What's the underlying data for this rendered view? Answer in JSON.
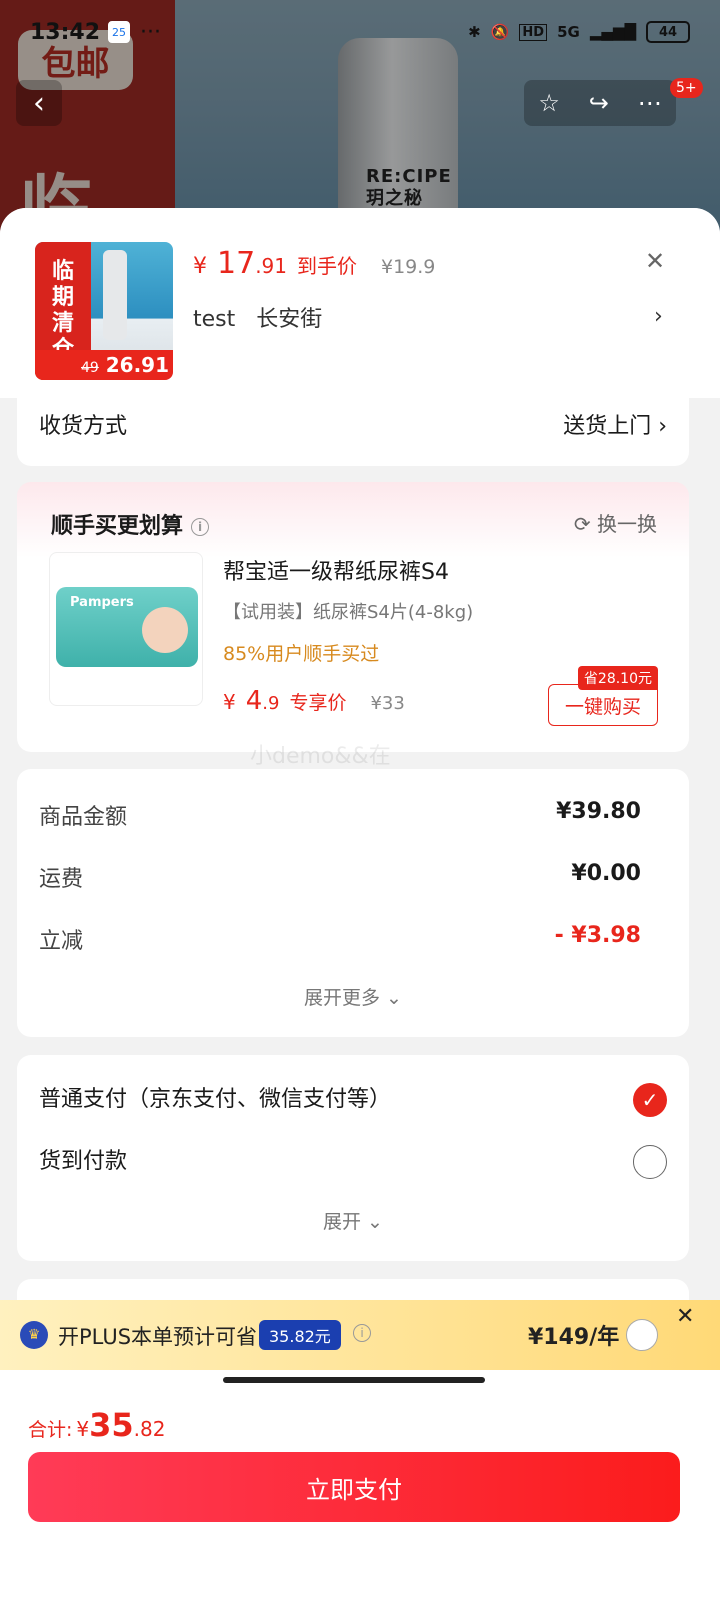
{
  "status_bar": {
    "time": "13:42",
    "notif": "25",
    "battery": "44",
    "network": "5G"
  },
  "background": {
    "badge_text": "包邮",
    "big_char": "临",
    "bottle_label": "RE:CIPE\n玥之秘",
    "cart_badge": "5+"
  },
  "header": {
    "price_symbol": "¥",
    "price_int": "17",
    "price_dec": ".91",
    "price_tag": "到手价",
    "original_price": "¥19.9",
    "address_name": "test",
    "address_street": "长安街",
    "thumb_tag": "临\n期\n清\n仓",
    "thumb_old": "49",
    "thumb_price": "26.91"
  },
  "delivery": {
    "label": "收货方式",
    "value": "送货上门 ›"
  },
  "upsell": {
    "title": "顺手买更划算",
    "swap": "换一换",
    "product_name": "帮宝适一级帮纸尿裤S4",
    "spec": "【试用装】纸尿裤S4片(4-8kg)",
    "rate": "85%用户顺手买过",
    "price_symbol": "¥",
    "price_int": "4",
    "price_dec": ".9",
    "price_tag": "专享价",
    "original_price": "¥33",
    "save_tag": "省28.10元",
    "buy_label": "一键购买",
    "pack_logo": "Pampers"
  },
  "costs": {
    "rows": [
      {
        "label": "商品金额",
        "value": "¥39.80"
      },
      {
        "label": "运费",
        "value": "¥0.00"
      },
      {
        "label": "立减",
        "value": "- ¥3.98"
      }
    ],
    "expand_more": "展开更多 ⌄"
  },
  "payment": {
    "options": [
      {
        "label": "普通支付（京东支付、微信支付等）",
        "selected": true
      },
      {
        "label": "货到付款",
        "selected": false
      }
    ],
    "expand": "展开 ⌄"
  },
  "plus": {
    "text": "开PLUS本单预计可省",
    "badge": "35.82元",
    "price": "¥149/年"
  },
  "footer": {
    "total_label": "合计:",
    "total_symbol": "¥",
    "total_int": "35",
    "total_dec": ".82",
    "pay_button": "立即支付"
  },
  "watermark": "小demo&&在",
  "colors": {
    "accent": "#e8261c",
    "plus_blue": "#1b3fb0",
    "rate_orange": "#d78a1f"
  }
}
